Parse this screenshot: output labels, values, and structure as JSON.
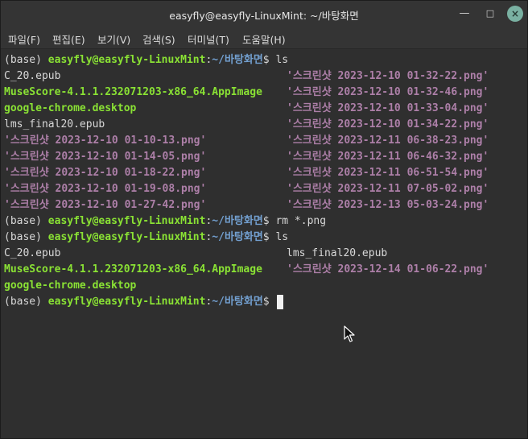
{
  "window": {
    "title": "easyfly@easyfly-LinuxMint: ~/바탕화면",
    "controls": {
      "minimize": "—",
      "maximize": "□",
      "close": "×"
    }
  },
  "menu": [
    "파일(F)",
    "편집(E)",
    "보기(V)",
    "검색(S)",
    "터미널(T)",
    "도움말(H)"
  ],
  "colors": {
    "background": "#2f2f2f",
    "user_host": "#8ae234",
    "path": "#729fcf",
    "executable": "#8ae234",
    "image_file": "#ad7fa8",
    "text": "#d8d8d8"
  },
  "prompt": {
    "env": "(base)",
    "user_host": "easyfly@easyfly-LinuxMint",
    "colon": ":",
    "path": "~/바탕화면",
    "symbol": "$"
  },
  "commands": [
    "ls",
    "rm *.png",
    "ls"
  ],
  "listing1": {
    "col1": [
      "C_20.epub",
      "MuseScore-4.1.1.232071203-x86_64.AppImage",
      "google-chrome.desktop",
      "lms_final20.epub",
      "'스크린샷 2023-12-10 01-10-13.png'",
      "'스크린샷 2023-12-10 01-14-05.png'",
      "'스크린샷 2023-12-10 01-18-22.png'",
      "'스크린샷 2023-12-10 01-19-08.png'",
      "'스크린샷 2023-12-10 01-27-42.png'"
    ],
    "col2": [
      "'스크린샷 2023-12-10 01-32-22.png'",
      "'스크린샷 2023-12-10 01-32-46.png'",
      "'스크린샷 2023-12-10 01-33-04.png'",
      "'스크린샷 2023-12-10 01-34-22.png'",
      "'스크린샷 2023-12-11 06-38-23.png'",
      "'스크린샷 2023-12-11 06-46-32.png'",
      "'스크린샷 2023-12-11 06-51-54.png'",
      "'스크린샷 2023-12-11 07-05-02.png'",
      "'스크린샷 2023-12-13 05-03-24.png'"
    ]
  },
  "listing2": {
    "col1": [
      "C_20.epub",
      "MuseScore-4.1.1.232071203-x86_64.AppImage",
      "google-chrome.desktop"
    ],
    "col2": [
      "lms_final20.epub",
      "'스크린샷 2023-12-14 01-06-22.png'"
    ]
  }
}
